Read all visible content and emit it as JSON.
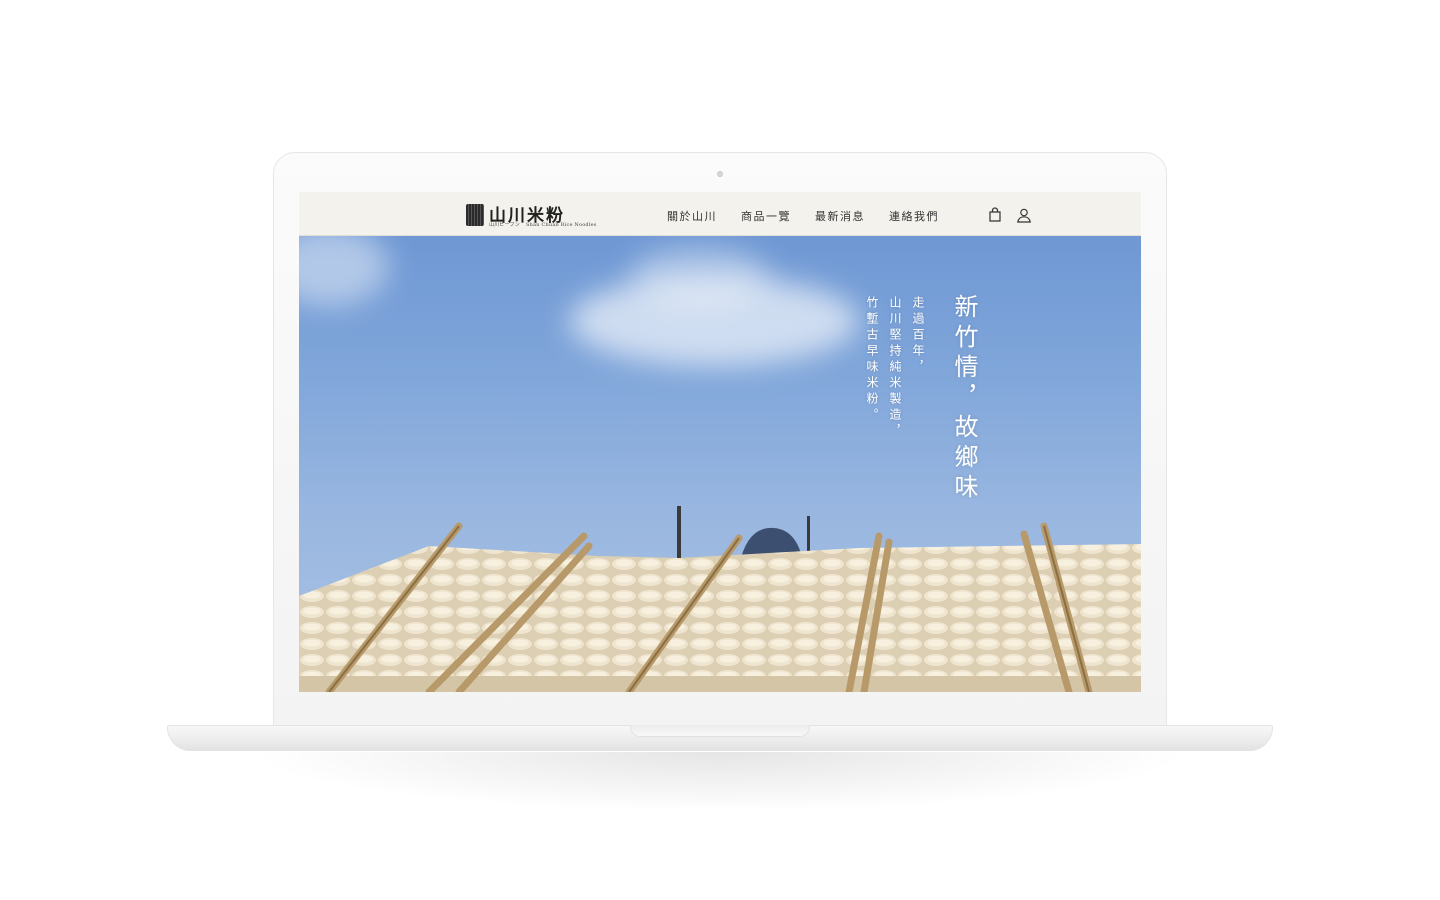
{
  "site": {
    "logo_title": "山川米粉",
    "logo_sub_jp": "山川ビーフン",
    "logo_sub_en": "Shan Chuan Rice Noodles"
  },
  "nav": {
    "items": [
      {
        "label": "關於山川"
      },
      {
        "label": "商品一覽"
      },
      {
        "label": "最新消息"
      },
      {
        "label": "連絡我們"
      }
    ],
    "cart_icon": "shopping-bag-icon",
    "user_icon": "user-icon"
  },
  "hero": {
    "headline": "新竹情，故鄉味",
    "copy_lines": [
      "走過百年，",
      "山川堅持純米製造，",
      "竹塹古早味米粉。"
    ]
  },
  "colors": {
    "header_bg": "#f3f2ec",
    "sky": "#80a6da",
    "text_dark": "#333333"
  }
}
